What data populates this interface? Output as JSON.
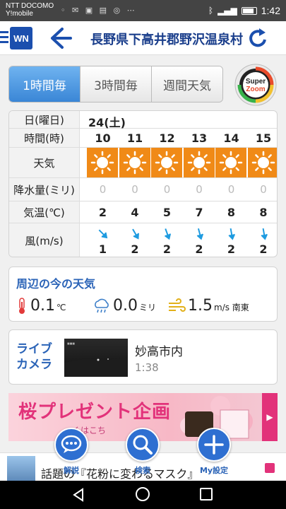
{
  "status_bar": {
    "carrier_line1": "NTT DOCOMO",
    "carrier_line2": "Y!mobile",
    "time": "1:42"
  },
  "app_bar": {
    "title": "長野県下高井郡野沢温泉村"
  },
  "tabs": [
    {
      "label": "1時間毎",
      "active": true
    },
    {
      "label": "3時間毎",
      "active": false
    },
    {
      "label": "週間天気",
      "active": false
    }
  ],
  "super_zoom": {
    "line1": "Super",
    "line2": "Zoom"
  },
  "hourly": {
    "row_labels": {
      "date": "日(曜日)",
      "hour": "時間(時)",
      "weather": "天気",
      "precip": "降水量(ミリ)",
      "temp": "気温(℃)",
      "wind": "風(m/s)"
    },
    "date": "24(土)",
    "hours": [
      "10",
      "11",
      "12",
      "13",
      "14",
      "15"
    ],
    "weather": [
      "sunny",
      "sunny",
      "sunny",
      "sunny",
      "sunny",
      "sunny"
    ],
    "precip": [
      "0",
      "0",
      "0",
      "0",
      "0",
      "0"
    ],
    "temp": [
      "2",
      "4",
      "5",
      "7",
      "8",
      "8"
    ],
    "wind_speed": [
      "1",
      "2",
      "2",
      "2",
      "2",
      "2"
    ],
    "wind_direction_deg": [
      135,
      150,
      160,
      165,
      170,
      170
    ]
  },
  "nearby_now": {
    "title": "周辺の今の天気",
    "temperature": {
      "value": "0.1",
      "unit": "℃",
      "icon": "thermometer-icon"
    },
    "precipitation": {
      "value": "0.0",
      "unit": "ミリ",
      "icon": "rain-cloud-icon"
    },
    "wind": {
      "value": "1.5",
      "unit": "m/s 南東",
      "icon": "wind-icon"
    }
  },
  "live_camera": {
    "label": "ライブ カメラ",
    "location": "妙高市内",
    "time": "1:38"
  },
  "banner": {
    "title": "桜プレゼント企画",
    "subtitle": "くはこち"
  },
  "news": {
    "text": "話題の『花粉に変わるマスク』"
  },
  "fabs": [
    {
      "label": "解説",
      "icon": "chat-bubble-icon"
    },
    {
      "label": "検索",
      "icon": "search-icon"
    },
    {
      "label": "My設定",
      "icon": "plus-icon"
    }
  ],
  "colors": {
    "brand_blue": "#2a63b7",
    "sun_orange": "#f08a17",
    "active_tab": "#3a86d6",
    "banner_pink": "#e2327a"
  }
}
